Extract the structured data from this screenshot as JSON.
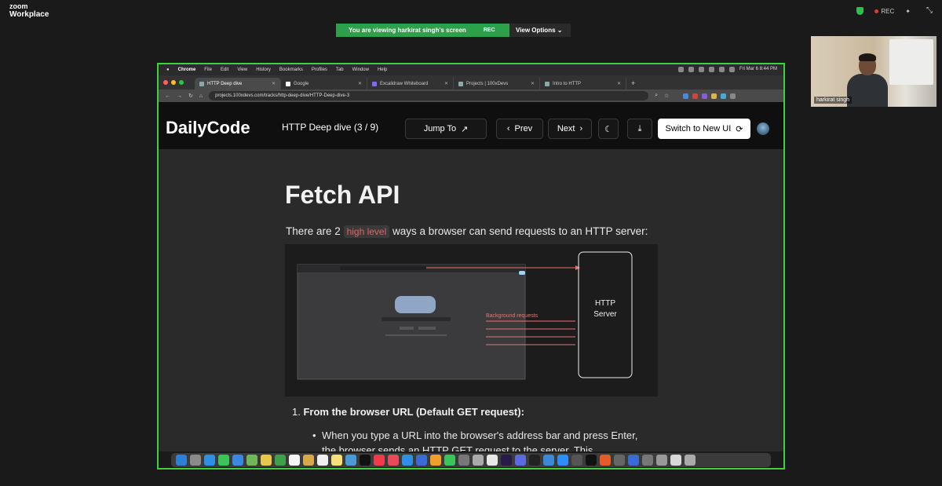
{
  "zoom": {
    "logo_line1": "zoom",
    "logo_line2": "Workplace",
    "rec_label": "REC",
    "viewing_text": "You are viewing",
    "viewing_name": "harkirat singh's screen",
    "viewing_rec": "REC",
    "view_options_label": "View Options",
    "participant_name": "harkirat singh"
  },
  "macos": {
    "menu_items": [
      "Chrome",
      "File",
      "Edit",
      "View",
      "History",
      "Bookmarks",
      "Profiles",
      "Tab",
      "Window",
      "Help"
    ],
    "clock": "Fri Mar 6  8:44 PM"
  },
  "browser": {
    "tabs": [
      {
        "label": "HTTP Deep dive",
        "active": true
      },
      {
        "label": "Google",
        "active": false
      },
      {
        "label": "Excalidraw Whiteboard",
        "active": false
      },
      {
        "label": "Projects | 100xDevs",
        "active": false
      },
      {
        "label": "Intro to HTTP",
        "active": false
      }
    ],
    "url": "projects.100xdevs.com/tracks/http-deep-dive/HTTP-Deep-dive-3"
  },
  "site": {
    "logo": "DailyCode",
    "track_title": "HTTP Deep dive (3 / 9)",
    "jump_label": "Jump To",
    "prev_label": "Prev",
    "next_label": "Next",
    "switch_label": "Switch to New UI"
  },
  "article": {
    "title": "Fetch API",
    "intro_before": "There are 2",
    "intro_code": "high level",
    "intro_after": "ways a browser can send requests to an HTTP server:",
    "diagram_server_line1": "HTTP",
    "diagram_server_line2": "Server",
    "diagram_arrow_label": "Background requests",
    "list_number": "1.",
    "list_heading": "From the browser URL (Default GET request):",
    "list_bullet": "When you type a URL into the browser's address bar and press Enter, the browser sends an HTTP GET request to the server. This"
  },
  "colors": {
    "share_border": "#3dd13a",
    "banner_green": "#2ca14a",
    "accent_red": "#e06464"
  }
}
